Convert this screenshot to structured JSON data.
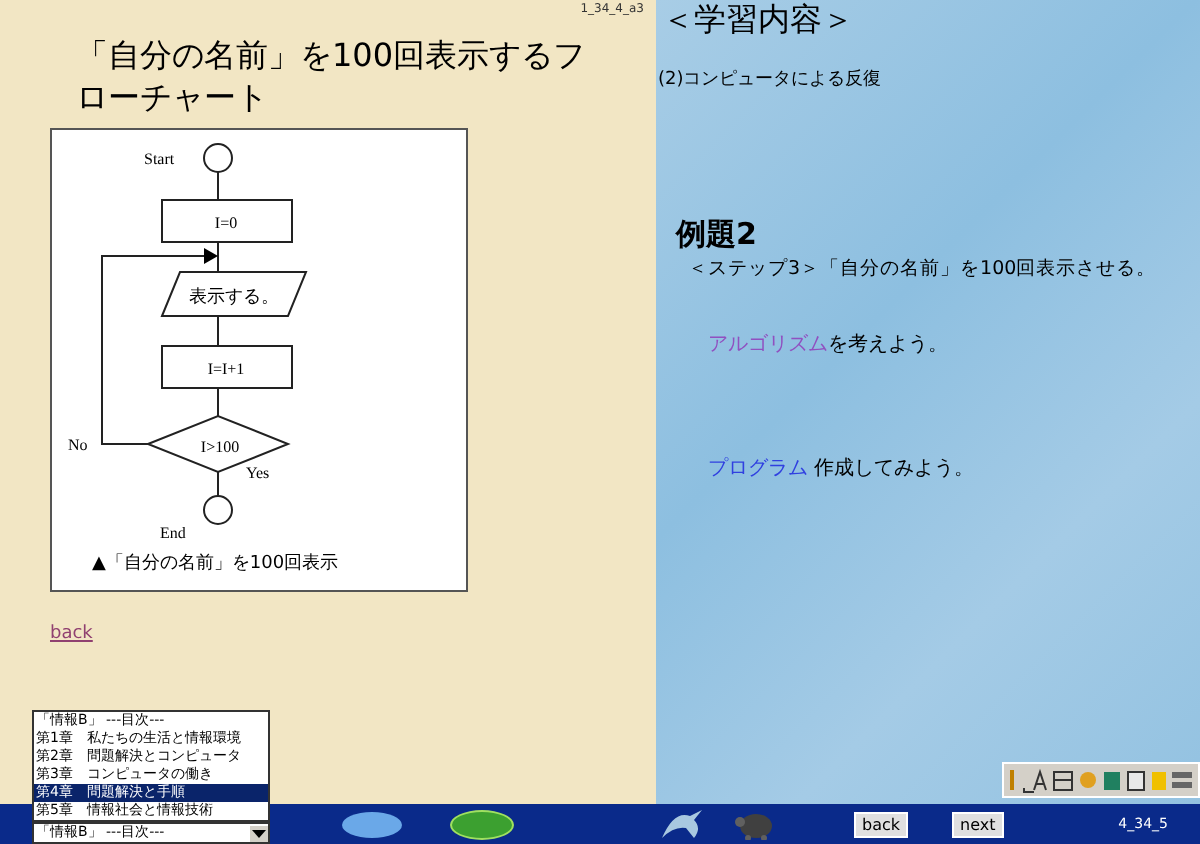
{
  "page_code": "1_34_4_a3",
  "title": "「自分の名前」を100回表示するフローチャート",
  "flowchart": {
    "start": "Start",
    "init": "I=0",
    "output": "表示する。",
    "increment": "I=I+1",
    "condition": "I>100",
    "no": "No",
    "yes": "Yes",
    "end": "End",
    "caption": "▲「自分の名前」を100回表示"
  },
  "back_link": "back",
  "content": {
    "heading": "＜学習内容＞",
    "subtitle": "(2)コンピュータによる反復",
    "example": "例題2",
    "step": "＜ステップ3＞「自分の名前」を100回表示させる。",
    "lines": [
      {
        "link": "アルゴリズム",
        "text": "を考えよう。",
        "visited": true
      },
      {
        "link": "プログラム",
        "text": " 作成してみよう。",
        "visited": false
      }
    ]
  },
  "chapter_menu": {
    "value": "「情報B」 ---目次---",
    "items": [
      {
        "label": "「情報B」 ---目次---",
        "highlighted": false
      },
      {
        "label": "第1章　私たちの生活と情報環境",
        "highlighted": false
      },
      {
        "label": "第2章　問題解決とコンピュータ",
        "highlighted": false
      },
      {
        "label": "第3章　コンピュータの働き",
        "highlighted": false
      },
      {
        "label": "第4章　問題解決と手順",
        "highlighted": true
      },
      {
        "label": "第5章　情報社会と情報技術",
        "highlighted": false
      }
    ]
  },
  "nav": {
    "back": "back",
    "next": "next",
    "page_code": "4_34_5"
  }
}
